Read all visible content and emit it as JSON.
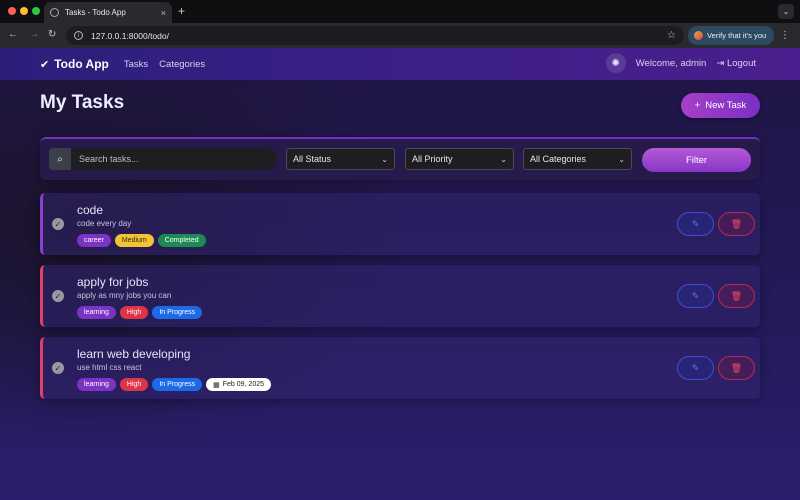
{
  "browser": {
    "tab_title": "Tasks - Todo App",
    "tab_close": "×",
    "new_tab": "+",
    "url": "127.0.0.1:8000/todo/",
    "verify_label": "Verify that it's you",
    "traffic_colors": [
      "#ff5f57",
      "#febc2e",
      "#28c840"
    ]
  },
  "navbar": {
    "brand": "Todo App",
    "links": [
      "Tasks",
      "Categories"
    ],
    "welcome": "Welcome, admin",
    "logout": "Logout"
  },
  "page": {
    "title": "My Tasks",
    "new_task_label": "New Task"
  },
  "filters": {
    "search_placeholder": "Search tasks...",
    "status": "All Status",
    "priority": "All Priority",
    "categories": "All Categories",
    "filter_label": "Filter"
  },
  "tasks": [
    {
      "title": "code",
      "description": "code every day",
      "category": "career",
      "priority": "Medium",
      "status": "Completed",
      "due": ""
    },
    {
      "title": "apply for jobs",
      "description": "apply as mny jobs you can",
      "category": "learning",
      "priority": "High",
      "status": "In Progress",
      "due": ""
    },
    {
      "title": "learn web developing",
      "description": "use html css react",
      "category": "learning",
      "priority": "High",
      "status": "In Progress",
      "due": "Feb 09, 2025"
    }
  ]
}
